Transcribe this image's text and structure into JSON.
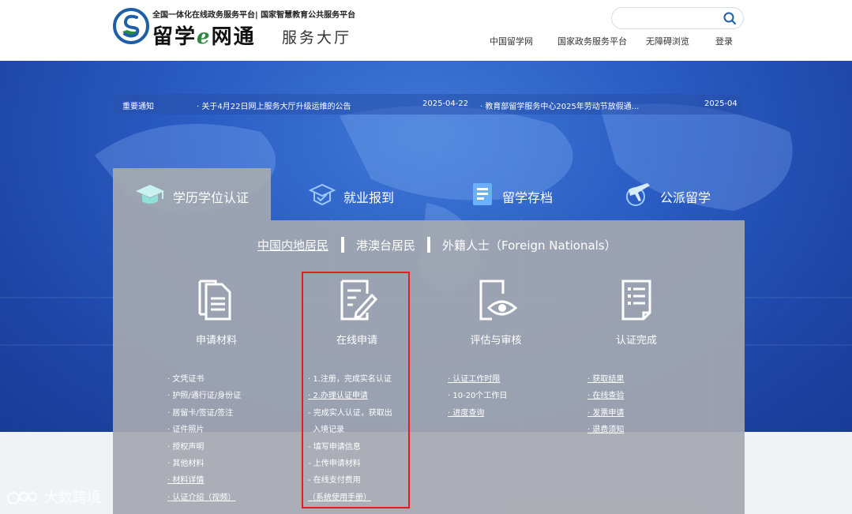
{
  "header": {
    "logo_top": "全国一体化在线政务服务平台| 国家智慧教育公共服务平台",
    "logo_title_a": "留学",
    "logo_title_e": "e",
    "logo_title_b": "网通",
    "logo_sub": "服务大厅",
    "search_placeholder": "",
    "nav": [
      "中国留学网",
      "国家政务服务平台",
      "无障碍浏览",
      "登录"
    ]
  },
  "notice": {
    "label": "重要通知",
    "items": [
      {
        "title": "· 关于4月22日网上服务大厅升级运维的公告",
        "date": "2025-04-22"
      },
      {
        "title": "· 教育部留学服务中心2025年劳动节放假通...",
        "date": "2025-04"
      }
    ]
  },
  "tabs": [
    {
      "label": "学历学位认证",
      "icon": "graduation-cap-icon"
    },
    {
      "label": "就业报到",
      "icon": "employment-report-icon"
    },
    {
      "label": "留学存档",
      "icon": "archive-file-icon"
    },
    {
      "label": "公派留学",
      "icon": "airplane-globe-icon"
    }
  ],
  "subtabs": [
    "中国内地居民",
    "港澳台居民",
    "外籍人士（Foreign Nationals）"
  ],
  "steps": [
    {
      "name": "申请材料",
      "icon": "documents-icon",
      "items": [
        "· 文凭证书",
        "· 护照/通行证/身份证",
        "· 居留卡/签证/签注",
        "· 证件照片",
        "· 授权声明",
        "· 其他材料",
        "· 材料详情",
        "· 认证介绍（视频）"
      ]
    },
    {
      "name": "在线申请",
      "icon": "edit-form-icon",
      "items": [
        "· 1.注册，完成实名认证",
        "· 2.办理认证申请",
        "- 完成实人认证，获取出",
        "入境记录",
        "- 填写申请信息",
        "- 上传申请材料",
        "- 在线支付费用",
        "（系统使用手册）"
      ]
    },
    {
      "name": "评估与审核",
      "icon": "review-eye-icon",
      "items": [
        "· 认证工作时限",
        "· 10-20个工作日",
        "· 进度查询"
      ]
    },
    {
      "name": "认证完成",
      "icon": "checklist-icon",
      "items": [
        "· 获取结果",
        "· 在线查验",
        "· 发票申请",
        "· 退费须知"
      ]
    }
  ],
  "watermark": "大数跨境",
  "colors": {
    "hero": "#2a5cc4",
    "panel": "#a5a8b0",
    "highlight": "#e02020"
  }
}
